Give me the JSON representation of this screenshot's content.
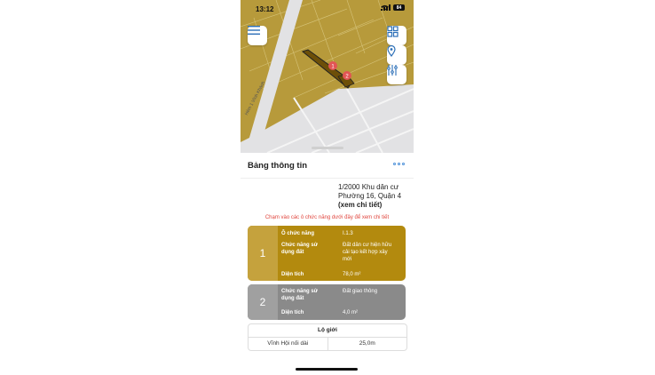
{
  "status": {
    "time": "13:12",
    "battery": "84"
  },
  "map": {
    "road_label": "Hẻm 1 Vĩnh Khánh",
    "markers": [
      "1",
      "2"
    ],
    "colors": {
      "land": "#b79a3b",
      "road": "#e2e2e4",
      "parcel": "#7a5a0a"
    }
  },
  "sheet": {
    "title": "Bảng thông tin",
    "plan_line1": "1/2000 Khu dân cư",
    "plan_line2": "Phường 16, Quận 4",
    "plan_link": "(xem chi tiết)",
    "hint": "Chạm vào các ô chức năng dưới đây để xem chi tiết"
  },
  "cards": [
    {
      "number": "1",
      "o_chuc_nang_label": "Ô chức năng",
      "o_chuc_nang_value": "I.1.3",
      "chuc_nang_label_1": "Chức năng sử",
      "chuc_nang_label_2": "dụng đất",
      "chuc_nang_value_1": "Đất dân cư hiện hữu",
      "chuc_nang_value_2": "cải tạo kết hợp xây",
      "chuc_nang_value_3": "mới",
      "dien_tich_label": "Diện tích",
      "dien_tich_value": "78,0 m²"
    },
    {
      "number": "2",
      "chuc_nang_label_1": "Chức năng sử",
      "chuc_nang_label_2": "dụng đất",
      "chuc_nang_value_1": "Đất giao thông",
      "dien_tich_label": "Diện tích",
      "dien_tich_value": "4,0 m²"
    }
  ],
  "lo_gioi": {
    "header": "Lộ giới",
    "road": "Vĩnh Hội nối dài",
    "width": "25,0m"
  }
}
